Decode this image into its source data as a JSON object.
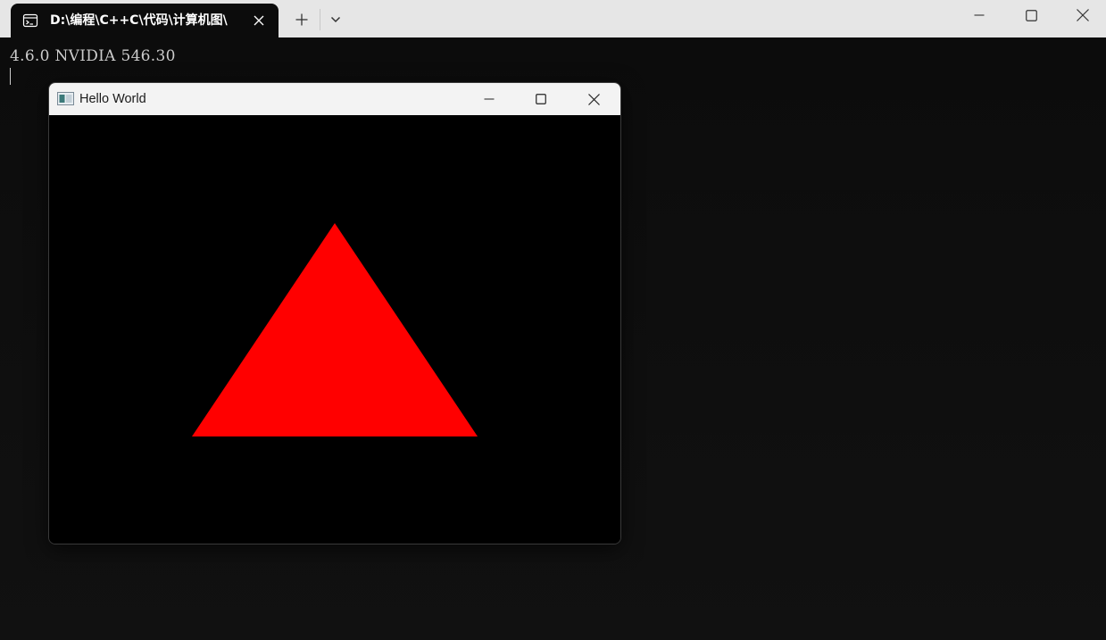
{
  "terminal": {
    "tab": {
      "title": "D:\\编程\\C++C\\代码\\计算机图\\",
      "icon": "terminal-icon"
    },
    "buttons": {
      "new_tab_icon": "plus-icon",
      "dropdown_icon": "chevron-down-icon",
      "minimize_icon": "minimize-icon",
      "maximize_icon": "maximize-icon",
      "close_icon": "close-icon"
    },
    "output_lines": [
      "4.6.0 NVIDIA 546.30"
    ],
    "colors": {
      "titlebar_bg": "#e6e6e6",
      "console_bg": "#0c0c0c",
      "console_text": "#cccccc"
    }
  },
  "child_window": {
    "title": "Hello World",
    "icon": "app-window-icon",
    "buttons": {
      "minimize_icon": "minimize-icon",
      "maximize_icon": "maximize-icon",
      "close_icon": "close-icon"
    },
    "canvas": {
      "background": "#000000",
      "shape": "triangle",
      "fill": "#ff0000"
    }
  }
}
